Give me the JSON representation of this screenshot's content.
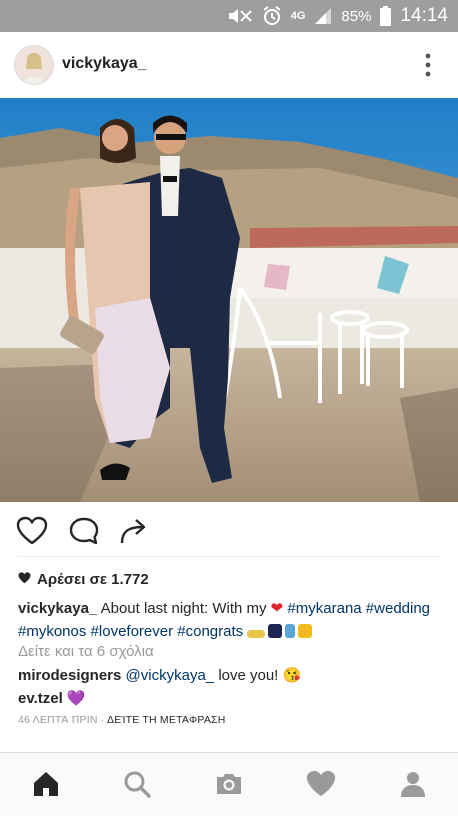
{
  "status_bar": {
    "network": "4G",
    "battery": "85%",
    "time": "14:14",
    "icons": [
      "mute-icon",
      "alarm-icon",
      "signal-icon",
      "battery-icon"
    ]
  },
  "post": {
    "username": "vickykaya_",
    "likes": "Αρέσει σε 1.772",
    "caption": {
      "user": "vickykaya_",
      "text_before": "About last night: With my",
      "heart_emoji": "❤",
      "hashtags_line1": [
        "#mykarana",
        "#wedding"
      ],
      "hashtags_line2": [
        "#mykonos",
        "#loveforever",
        "#congrats"
      ]
    },
    "view_comments": "Δείτε και τα 6 σχόλια",
    "comments": [
      {
        "user": "mirodesigners",
        "mention": "@vickykaya_",
        "text": "love you!",
        "emoji": "😘"
      },
      {
        "user": "ev.tzel",
        "mention": "",
        "text": "",
        "emoji": "💜"
      }
    ],
    "timestamp": "46 ΛΕΠΤΆ ΠΡΙΝ",
    "separator": "·",
    "translate": "ΔΕΊΤΕ ΤΗ ΜΕΤΑΦΡΑΣΗ"
  },
  "colors": {
    "status_bar": "#9e9e9e",
    "hashtag": "#003569",
    "muted": "#999999",
    "heart": "#e0232c",
    "purple_heart": "#9b27c6"
  },
  "tab_bar": {
    "tabs": [
      "home-icon",
      "search-icon",
      "camera-icon",
      "heart-icon",
      "profile-icon"
    ]
  }
}
